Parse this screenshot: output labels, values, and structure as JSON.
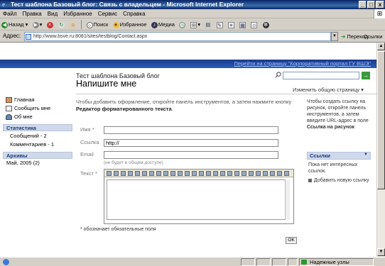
{
  "window": {
    "title": "Тест шаблона Базовый блог: Связь с владельцем - Microsoft Internet Explorer",
    "min": "_",
    "max": "□",
    "close": "x"
  },
  "menu": [
    "Файл",
    "Правка",
    "Вид",
    "Избранное",
    "Сервис",
    "Справка"
  ],
  "toolbar": {
    "back": "Назад",
    "search": "Поиск",
    "favorites": "Избранное",
    "media": "Медиа"
  },
  "address": {
    "label": "Адрес:",
    "url": "http://www.bsve.ru:8081/sites/testblog/Contact.aspx",
    "go": "Переход",
    "links": "Ссылки"
  },
  "page": {
    "top_link": "Перейти на страницу \"Корпоративный портал ГУ ВШЭ\"",
    "search_go": "→",
    "blog_title": "Тест шаблона Базовый блог",
    "page_title": "Напишите мне",
    "change_page": "Изменить общую страницу ▾"
  },
  "sidebar": {
    "nav": [
      {
        "label": "Главная",
        "icon": "home-icon"
      },
      {
        "label": "Сообщить мне",
        "icon": "email-icon"
      },
      {
        "label": "Об мне",
        "icon": "user-icon"
      }
    ],
    "stats_head": "Статистика",
    "stats": [
      "Сообщений - 2",
      "Комментариев - 1"
    ],
    "archive_head": "Архивы",
    "archive": [
      "Май, 2005 (2)"
    ]
  },
  "form": {
    "instructions_1": "Чтобы добавить оформление, откройте панель инструментов, а затем нажмите кнопку ",
    "instructions_bold": "Редактор форматированного текста",
    "instructions_2": ".",
    "name_label": "Имя *",
    "link_label": "Ссылка",
    "link_value": "http://",
    "email_label": "Email",
    "email_note": "(не будет в общем доступе)",
    "text_label": "Текст *",
    "required_note": "* обозначает обязательные поля",
    "ok": "OK"
  },
  "right": {
    "help_1": "Чтобы создать ссылку на рисунок, откройте панель инструментов, а затем введите URL-адрес в поле ",
    "help_bold": "Ссылка на рисунок",
    "links_head": "Ссылки",
    "no_links": "Пока нет интересных ссылок.",
    "add_link": "Добавить новую ссылку"
  },
  "status": {
    "zone": "Надежные узлы"
  }
}
